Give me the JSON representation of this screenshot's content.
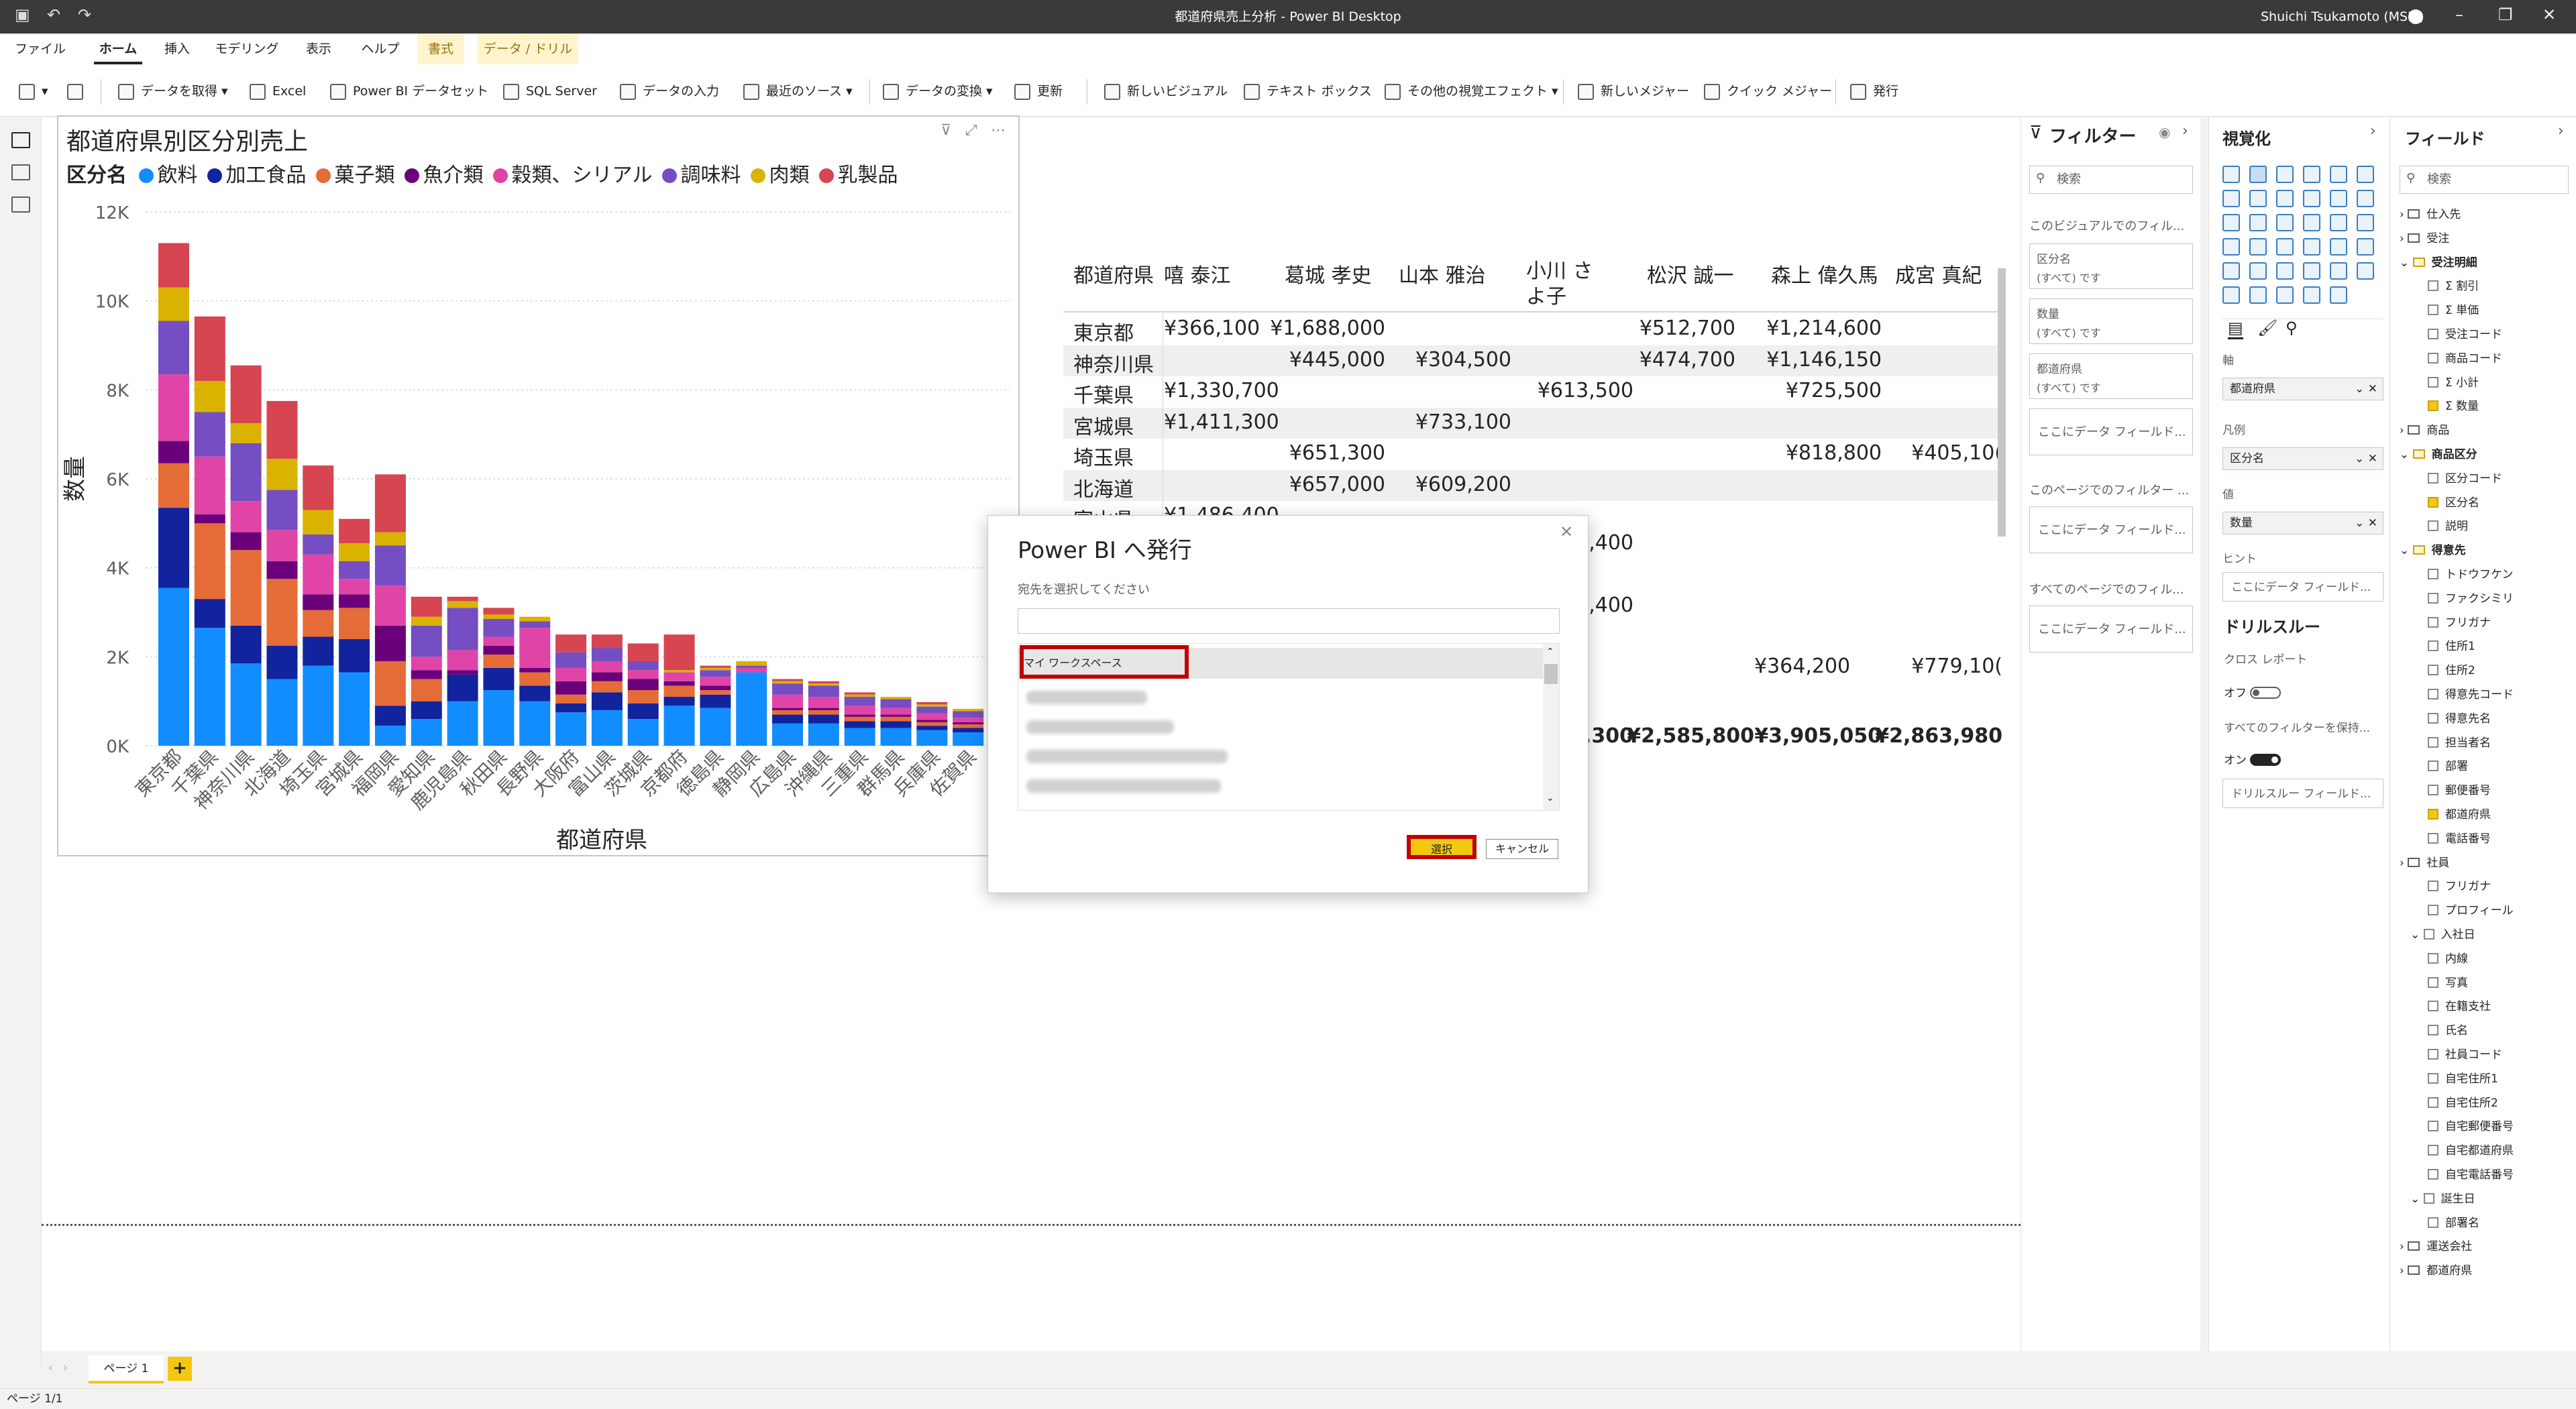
{
  "window": {
    "title": "都道府県売上分析 - Power BI Desktop",
    "user": "Shuichi Tsukamoto (MSIT)"
  },
  "tabs": [
    "ファイル",
    "ホーム",
    "挿入",
    "モデリング",
    "表示",
    "ヘルプ",
    "書式",
    "データ / ドリル"
  ],
  "ribbon": [
    "データを取得",
    "Excel",
    "Power BI データセット",
    "SQL Server",
    "データの入力",
    "最近のソース",
    "データの変換",
    "更新",
    "新しいビジュアル",
    "テキスト ボックス",
    "その他の視覚エフェクト",
    "新しいメジャー",
    "クイック メジャー",
    "発行"
  ],
  "chart": {
    "title": "都道府県別区分別売上",
    "legend_title": "区分名",
    "xlabel": "都道府県",
    "ylabel": "数量"
  },
  "chart_data": {
    "type": "bar",
    "stacked": true,
    "title": "都道府県別区分別売上",
    "xlabel": "都道府県",
    "ylabel": "数量",
    "ylim": [
      0,
      12000
    ],
    "yticks": [
      "0K",
      "2K",
      "4K",
      "6K",
      "8K",
      "10K",
      "12K"
    ],
    "grid": true,
    "legend_position": "top-left",
    "categories": [
      "東京都",
      "千葉県",
      "神奈川県",
      "北海道",
      "埼玉県",
      "宮城県",
      "福岡県",
      "愛知県",
      "鹿児島県",
      "秋田県",
      "長野県",
      "大阪府",
      "富山県",
      "茨城県",
      "京都府",
      "徳島県",
      "静岡県",
      "広島県",
      "沖縄県",
      "三重県",
      "群馬県",
      "兵庫県",
      "佐賀県",
      ""
    ],
    "series": [
      {
        "name": "飲料",
        "color": "#118dff",
        "values": [
          3550,
          2650,
          1850,
          1500,
          1800,
          1650,
          450,
          600,
          1000,
          1250,
          1000,
          750,
          800,
          600,
          900,
          850,
          1650,
          500,
          500,
          400,
          400,
          350,
          300,
          200
        ]
      },
      {
        "name": "加工食品",
        "color": "#12239e",
        "values": [
          1800,
          650,
          850,
          750,
          650,
          750,
          450,
          400,
          600,
          500,
          350,
          200,
          400,
          350,
          200,
          300,
          0,
          200,
          200,
          150,
          150,
          100,
          100,
          50
        ]
      },
      {
        "name": "菓子類",
        "color": "#e66c37",
        "values": [
          1000,
          1700,
          1700,
          1500,
          600,
          700,
          1000,
          500,
          0,
          300,
          300,
          200,
          250,
          300,
          250,
          100,
          0,
          100,
          100,
          100,
          100,
          80,
          80,
          50
        ]
      },
      {
        "name": "魚介類",
        "color": "#6b007b",
        "values": [
          500,
          200,
          400,
          400,
          350,
          300,
          800,
          200,
          100,
          200,
          100,
          300,
          200,
          250,
          100,
          100,
          0,
          50,
          50,
          50,
          50,
          50,
          50,
          30
        ]
      },
      {
        "name": "穀類、シリアル",
        "color": "#e044a7",
        "values": [
          1500,
          1300,
          700,
          700,
          900,
          350,
          900,
          300,
          450,
          200,
          900,
          300,
          250,
          200,
          200,
          200,
          100,
          300,
          250,
          200,
          150,
          150,
          100,
          50
        ]
      },
      {
        "name": "調味料",
        "color": "#744ec2",
        "values": [
          1200,
          1000,
          1300,
          900,
          450,
          400,
          900,
          700,
          950,
          400,
          150,
          350,
          300,
          200,
          0,
          150,
          50,
          250,
          250,
          200,
          200,
          150,
          150,
          50
        ]
      },
      {
        "name": "肉類",
        "color": "#d9b300",
        "values": [
          750,
          700,
          450,
          700,
          550,
          400,
          300,
          200,
          150,
          100,
          100,
          0,
          0,
          0,
          50,
          50,
          100,
          50,
          50,
          50,
          50,
          50,
          50,
          0
        ]
      },
      {
        "name": "乳製品",
        "color": "#d64550",
        "values": [
          1000,
          1450,
          1300,
          1300,
          1000,
          550,
          1300,
          450,
          100,
          150,
          0,
          400,
          300,
          400,
          800,
          50,
          0,
          50,
          50,
          50,
          0,
          50,
          0,
          20
        ]
      }
    ]
  },
  "matrix": {
    "headers": [
      "都道府県",
      "嘻 泰江",
      "葛城 孝史",
      "山本 雅治",
      "小川 さよ子",
      "松沢 誠一",
      "森上 偉久馬",
      "成宮 真紀"
    ],
    "rows": [
      [
        "東京都",
        "¥366,100",
        "¥1,688,000",
        "",
        "",
        "¥512,700",
        "¥1,214,600",
        ""
      ],
      [
        "神奈川県",
        "",
        "¥445,000",
        "¥304,500",
        "",
        "¥474,700",
        "¥1,146,150",
        ""
      ],
      [
        "千葉県",
        "¥1,330,700",
        "",
        "",
        "¥613,500",
        "",
        "¥725,500",
        ""
      ],
      [
        "宮城県",
        "¥1,411,300",
        "",
        "¥733,100",
        "",
        "",
        "",
        ""
      ],
      [
        "埼玉県",
        "",
        "¥651,300",
        "",
        "",
        "",
        "¥818,800",
        "¥405,10("
      ],
      [
        "北海道",
        "",
        "¥657,000",
        "¥609,200",
        "",
        "",
        "",
        ""
      ],
      [
        "富山県",
        "¥1,486,400",
        "",
        "",
        "",
        "",
        "",
        ""
      ]
    ],
    "partial": [
      "7,400",
      "5,400",
      "¥364,200",
      "¥779,10("
    ],
    "totals": [
      "7,300",
      "¥2,585,800",
      "¥3,905,050",
      "¥2,863,980"
    ]
  },
  "dialog": {
    "title": "Power BI へ発行",
    "subtitle": "宛先を選択してください",
    "search_value": "",
    "selected_item": "マイ ワークスペース",
    "select_button": "選択",
    "cancel_button": "キャンセル"
  },
  "filters": {
    "title": "フィルター",
    "search_placeholder": "検索",
    "visual_section": "このビジュアルでのフィル...",
    "cards": [
      {
        "name": "区分名",
        "value": "(すべて) です"
      },
      {
        "name": "数量",
        "value": "(すべて) です"
      },
      {
        "name": "都道府県",
        "value": "(すべて) です"
      }
    ],
    "drop_label": "ここにデータ フィールド...",
    "page_section": "このページでのフィルター ...",
    "all_section": "すべてのページでのフィル..."
  },
  "visualizations": {
    "title": "視覚化",
    "axis_label": "軸",
    "axis_value": "都道府県",
    "legend_label": "凡例",
    "legend_value": "区分名",
    "values_label": "値",
    "values_value": "数量",
    "tooltip_label": "ヒント",
    "tooltip_drop": "ここにデータ フィールド...",
    "drill_title": "ドリルスルー",
    "cross_report": "クロス レポート",
    "cross_state": "オフ",
    "keep_filters": "すべてのフィルターを保持...",
    "keep_state": "オン",
    "drill_drop": "ドリルスルー フィールド..."
  },
  "fields": {
    "title": "フィールド",
    "search_placeholder": "検索",
    "items": [
      {
        "type": "table",
        "label": "仕入先",
        "checked": false
      },
      {
        "type": "table",
        "label": "受注",
        "checked": false
      },
      {
        "type": "table-bold",
        "label": "受注明細",
        "checked": true
      },
      {
        "type": "field",
        "label": "Σ 割引",
        "checked": false
      },
      {
        "type": "field",
        "label": "Σ 単価",
        "checked": false
      },
      {
        "type": "field",
        "label": "受注コード",
        "checked": false
      },
      {
        "type": "field",
        "label": "商品コード",
        "checked": false
      },
      {
        "type": "field",
        "label": "Σ 小計",
        "checked": false
      },
      {
        "type": "field",
        "label": "Σ 数量",
        "checked": true
      },
      {
        "type": "table",
        "label": "商品",
        "checked": false
      },
      {
        "type": "table-bold",
        "label": "商品区分",
        "checked": true
      },
      {
        "type": "field",
        "label": "区分コード",
        "checked": false
      },
      {
        "type": "field",
        "label": "区分名",
        "checked": true
      },
      {
        "type": "field",
        "label": "説明",
        "checked": false
      },
      {
        "type": "table-bold",
        "label": "得意先",
        "checked": true
      },
      {
        "type": "field",
        "label": "トドウフケン",
        "checked": false
      },
      {
        "type": "field",
        "label": "ファクシミリ",
        "checked": false
      },
      {
        "type": "field",
        "label": "フリガナ",
        "checked": false
      },
      {
        "type": "field",
        "label": "住所1",
        "checked": false
      },
      {
        "type": "field",
        "label": "住所2",
        "checked": false
      },
      {
        "type": "field",
        "label": "得意先コード",
        "checked": false
      },
      {
        "type": "field",
        "label": "得意先名",
        "checked": false
      },
      {
        "type": "field",
        "label": "担当者名",
        "checked": false
      },
      {
        "type": "field",
        "label": "部署",
        "checked": false
      },
      {
        "type": "field",
        "label": "郵便番号",
        "checked": false
      },
      {
        "type": "field",
        "label": "都道府県",
        "checked": true
      },
      {
        "type": "field",
        "label": "電話番号",
        "checked": false
      },
      {
        "type": "table",
        "label": "社員",
        "checked": false
      },
      {
        "type": "field",
        "label": "フリガナ",
        "checked": false
      },
      {
        "type": "field",
        "label": "プロフィール",
        "checked": false
      },
      {
        "type": "subtable",
        "label": "入社日",
        "checked": false
      },
      {
        "type": "field",
        "label": "内線",
        "checked": false
      },
      {
        "type": "field",
        "label": "写真",
        "checked": false
      },
      {
        "type": "field",
        "label": "在籍支社",
        "checked": false
      },
      {
        "type": "field",
        "label": "氏名",
        "checked": false
      },
      {
        "type": "field",
        "label": "社員コード",
        "checked": false
      },
      {
        "type": "field",
        "label": "自宅住所1",
        "checked": false
      },
      {
        "type": "field",
        "label": "自宅住所2",
        "checked": false
      },
      {
        "type": "field",
        "label": "自宅郵便番号",
        "checked": false
      },
      {
        "type": "field",
        "label": "自宅都道府県",
        "checked": false
      },
      {
        "type": "field",
        "label": "自宅電話番号",
        "checked": false
      },
      {
        "type": "subtable",
        "label": "誕生日",
        "checked": false
      },
      {
        "type": "field",
        "label": "部署名",
        "checked": false
      },
      {
        "type": "table",
        "label": "運送会社",
        "checked": false
      },
      {
        "type": "table",
        "label": "都道府県",
        "checked": false
      }
    ]
  },
  "pages": {
    "tab": "ページ 1",
    "add": "+",
    "status": "ページ 1/1"
  }
}
